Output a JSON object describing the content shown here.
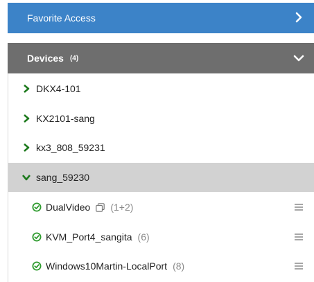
{
  "favorite_access": {
    "label": "Favorite Access",
    "icon": "chevron-right-icon"
  },
  "devices": {
    "label": "Devices",
    "count": "(4)",
    "icon": "chevron-down-icon",
    "items": [
      {
        "name": "DKX4-101",
        "expanded": false
      },
      {
        "name": "KX2101-sang",
        "expanded": false
      },
      {
        "name": "kx3_808_59231",
        "expanded": false
      },
      {
        "name": "sang_59230",
        "expanded": true,
        "selected": true
      }
    ],
    "ports": [
      {
        "name": "DualVideo",
        "detail": "(1+2)",
        "has_multi_icon": true
      },
      {
        "name": "KVM_Port4_sangita",
        "detail": "(6)"
      },
      {
        "name": "Windows10Martin-LocalPort",
        "detail": "(8)"
      }
    ]
  },
  "colors": {
    "favorite_bg": "#3c83c8",
    "devices_header_bg": "#6e6e6e",
    "selected_row_bg": "#d2d2d2",
    "accent_green": "#1e7a1e",
    "status_green": "#2e9b2e"
  }
}
